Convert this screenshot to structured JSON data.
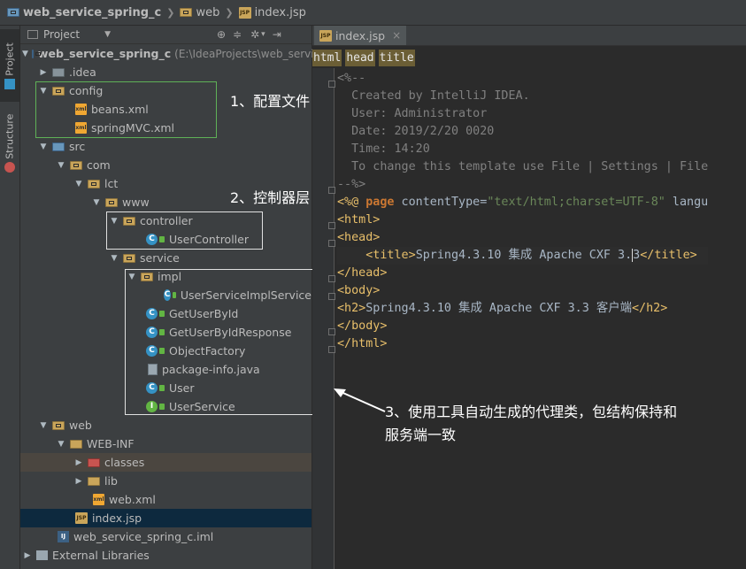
{
  "breadcrumb": {
    "items": [
      {
        "label": "web_service_spring_c",
        "icon": "module-folder-icon"
      },
      {
        "label": "web",
        "icon": "web-folder-icon"
      },
      {
        "label": "index.jsp",
        "icon": "jsp-file-icon"
      }
    ]
  },
  "sidebar": {
    "tabs": [
      {
        "label": "1: Project",
        "active": true
      },
      {
        "label": "7: Structure",
        "active": false
      }
    ]
  },
  "project_panel": {
    "title": "Project",
    "tree": [
      {
        "label": "web_service_spring_c",
        "path": "(E:\\IdeaProjects\\web_servic",
        "bold": true
      },
      {
        "label": ".idea"
      },
      {
        "label": "config"
      },
      {
        "label": "beans.xml"
      },
      {
        "label": "springMVC.xml"
      },
      {
        "label": "src"
      },
      {
        "label": "com"
      },
      {
        "label": "lct"
      },
      {
        "label": "www"
      },
      {
        "label": "controller"
      },
      {
        "label": "UserController"
      },
      {
        "label": "service"
      },
      {
        "label": "impl"
      },
      {
        "label": "UserServiceImplService"
      },
      {
        "label": "GetUserById"
      },
      {
        "label": "GetUserByIdResponse"
      },
      {
        "label": "ObjectFactory"
      },
      {
        "label": "package-info.java"
      },
      {
        "label": "User"
      },
      {
        "label": "UserService"
      },
      {
        "label": "web"
      },
      {
        "label": "WEB-INF"
      },
      {
        "label": "classes"
      },
      {
        "label": "lib"
      },
      {
        "label": "web.xml"
      },
      {
        "label": "index.jsp"
      },
      {
        "label": "web_service_spring_c.iml"
      },
      {
        "label": "External Libraries"
      }
    ]
  },
  "editor": {
    "tab_label": "index.jsp",
    "crumbs": [
      "html",
      "head",
      "title"
    ],
    "lines": [
      "<%--",
      "  Created by IntelliJ IDEA.",
      "  User: Administrator",
      "  Date: 2019/2/20 0020",
      "  Time: 14:20",
      "  To change this template use File | Settings | File",
      "--%>",
      "<%@ page contentType=\"text/html;charset=UTF-8\" langu",
      "<html>",
      "<head>",
      "    <title>Spring4.3.10 集成 Apache CXF 3.3</title>",
      "</head>",
      "<body>",
      "<h2>Spring4.3.10 集成 Apache CXF 3.3 客户端</h2>",
      "</body>",
      "</html>"
    ]
  },
  "annotations": {
    "a1": "1、配置文件",
    "a2": "2、控制器层",
    "a3_line1": "3、使用工具自动生成的代理类，包结构保持和",
    "a3_line2": "服务端一致"
  },
  "colors": {
    "accent_green_box": "#5fb157",
    "selection": "#0d293e",
    "tag_yellow": "#e8bf6a",
    "keyword_orange": "#cc7832",
    "string_green": "#6a8759"
  }
}
